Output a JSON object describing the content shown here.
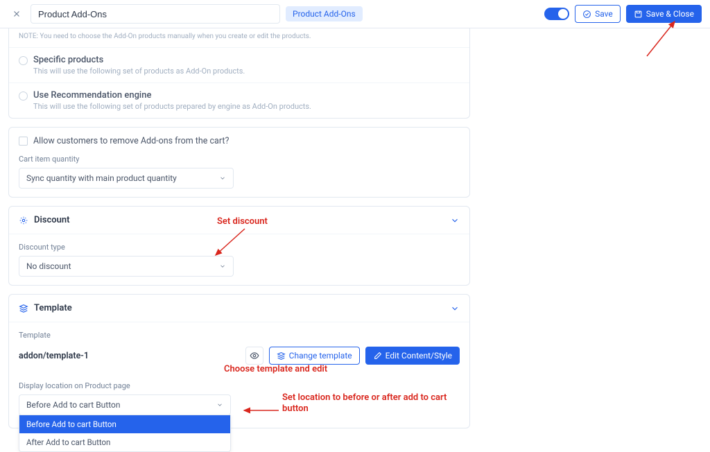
{
  "header": {
    "title_value": "Product Add-Ons",
    "tag": "Product Add-Ons",
    "save": "Save",
    "save_close": "Save & Close"
  },
  "product_options": {
    "note": "NOTE: You need to choose the Add-On products manually when you create or edit the products.",
    "specific_title": "Specific products",
    "specific_desc": "This will use the following set of products as Add-On products.",
    "rec_title": "Use Recommendation engine",
    "rec_desc": "This will use the following set of products prepared by engine as Add-On products."
  },
  "allow_remove": "Allow customers to remove Add-ons from the cart?",
  "cart_qty_label": "Cart item quantity",
  "cart_qty_value": "Sync quantity with main product quantity",
  "discount": {
    "title": "Discount",
    "type_label": "Discount type",
    "type_value": "No discount"
  },
  "template": {
    "title": "Template",
    "label": "Template",
    "value": "addon/template-1",
    "change": "Change template",
    "edit": "Edit Content/Style",
    "display_label": "Display location on Product page",
    "display_value": "Before Add to cart Button",
    "options": [
      "Before Add to cart Button",
      "After Add to cart Button"
    ]
  },
  "annotations": {
    "set_discount": "Set discount",
    "choose_template": "Choose template and edit",
    "set_location": "Set location to before or after add to cart button"
  }
}
